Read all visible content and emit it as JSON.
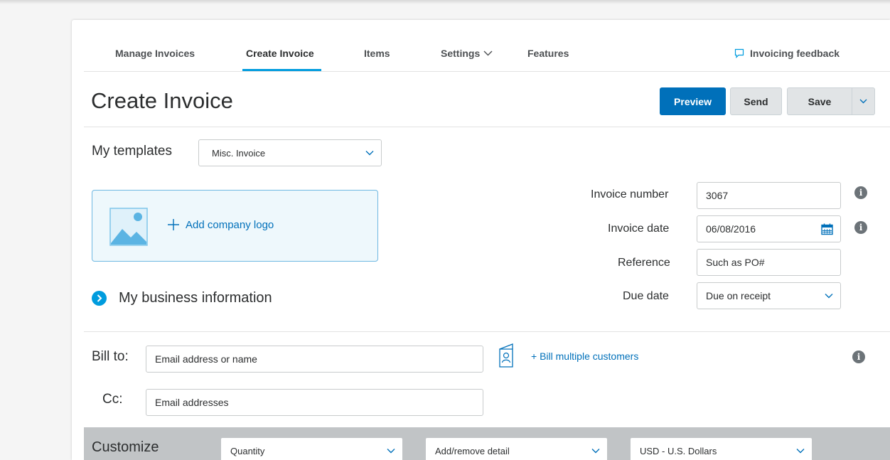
{
  "nav": {
    "manage_invoices": "Manage Invoices",
    "create_invoice": "Create Invoice",
    "items": "Items",
    "settings": "Settings",
    "features": "Features",
    "feedback": "Invoicing feedback"
  },
  "header": {
    "title": "Create Invoice",
    "preview": "Preview",
    "send": "Send",
    "save": "Save"
  },
  "templates": {
    "label": "My templates",
    "selected": "Misc. Invoice"
  },
  "logo": {
    "add_label": "Add company logo"
  },
  "business": {
    "label": "My business information"
  },
  "invoice": {
    "number_label": "Invoice number",
    "number_value": "3067",
    "date_label": "Invoice date",
    "date_value": "06/08/2016",
    "reference_label": "Reference",
    "reference_placeholder": "Such as PO#",
    "due_label": "Due date",
    "due_value": "Due on receipt"
  },
  "bill": {
    "to_label": "Bill to:",
    "to_placeholder": "Email address or name",
    "cc_label": "Cc:",
    "cc_placeholder": "Email addresses",
    "multiple_link": "+ Bill multiple customers"
  },
  "customize": {
    "label": "Customize",
    "quantity": "Quantity",
    "detail": "Add/remove detail",
    "currency": "USD - U.S. Dollars"
  },
  "colors": {
    "accent": "#0070ba",
    "tab_underline": "#009cde",
    "customize_bar": "#c1c4c6"
  },
  "icons": [
    "chevron-down-icon",
    "speech-bubble-icon",
    "image-placeholder-icon",
    "plus-icon",
    "chevron-right-circle-icon",
    "calendar-icon",
    "info-icon",
    "contact-book-icon"
  ]
}
